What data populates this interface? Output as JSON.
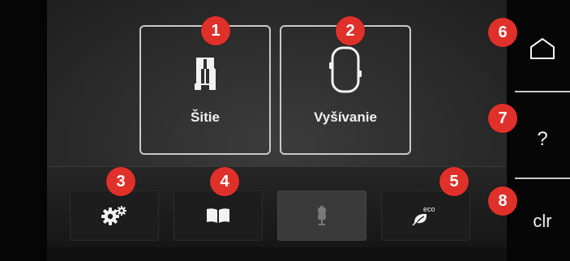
{
  "modes": [
    {
      "label": "Šitie",
      "icon": "presser-foot-icon"
    },
    {
      "label": "Vyšívanie",
      "icon": "embroidery-hoop-icon"
    }
  ],
  "toolbar": [
    {
      "icon": "settings-gears-icon",
      "enabled": true
    },
    {
      "icon": "tutorial-book-icon",
      "enabled": true
    },
    {
      "icon": "dress-form-icon",
      "enabled": false
    },
    {
      "icon": "eco-leaf-icon",
      "enabled": true,
      "eco_text": "eco"
    }
  ],
  "sidebar": {
    "home_icon": "home-icon",
    "help_label": "?",
    "clear_label": "clr"
  },
  "badges": [
    "1",
    "2",
    "3",
    "4",
    "5",
    "6",
    "7",
    "8"
  ],
  "colors": {
    "badge": "#e0302a",
    "tile_border": "#c9c9c9",
    "background": "#2c2c2c"
  }
}
